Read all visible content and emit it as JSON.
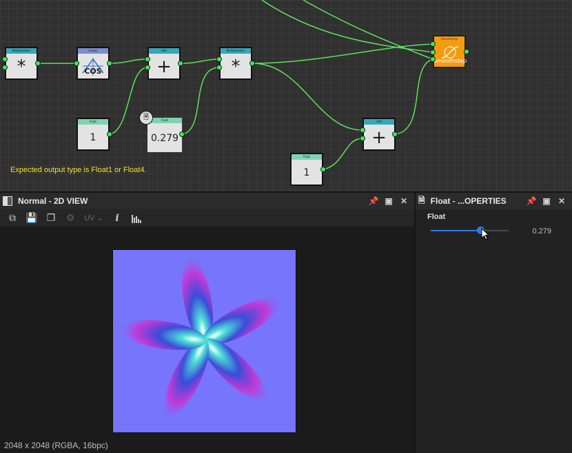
{
  "graph": {
    "warning": "Expected output type is Float1 or Float4.",
    "nodes": [
      {
        "id": "mul1",
        "header": "Multiplication",
        "symbol": "*"
      },
      {
        "id": "cos",
        "header": "Cosine",
        "symbol": "COS"
      },
      {
        "id": "add1",
        "header": "Add",
        "symbol": "+"
      },
      {
        "id": "mul2",
        "header": "Multiplication",
        "symbol": "*"
      },
      {
        "id": "smooth",
        "header": "Smoothstep",
        "symbol": "smoothstep"
      },
      {
        "id": "f1",
        "header": "Float",
        "symbol": "1"
      },
      {
        "id": "f279",
        "header": "Float",
        "symbol": "0.279"
      },
      {
        "id": "add2",
        "header": "Add",
        "symbol": "+"
      },
      {
        "id": "f2",
        "header": "Float",
        "symbol": "1"
      }
    ]
  },
  "view2d": {
    "title": "Normal - 2D VIEW",
    "uv_label": "UV",
    "resolution": "2048 x 2048 (RGBA, 16bpc)",
    "colors": {
      "preview_bg": "#7775fb"
    }
  },
  "props": {
    "title": "Float - ...OPERTIES",
    "label": "Float",
    "value": "0.279",
    "slider_fraction": 0.64,
    "colors": {
      "accent": "#2f7de1"
    }
  },
  "colors": {
    "wire": "#5ee35a",
    "port": "#45e55e",
    "warning": "#f3e331",
    "smoothstep": "#f39c12"
  }
}
